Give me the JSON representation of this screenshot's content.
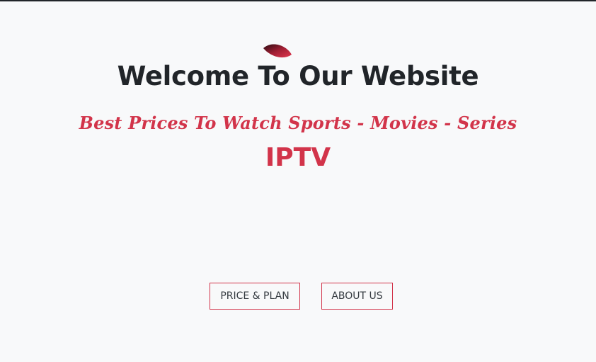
{
  "hero": {
    "logo_icon": "leaf-logo-icon",
    "title": "Welcome To Our Website",
    "subtitle": "Best Prices To Watch Sports - Movies - Series",
    "brand": "IPTV"
  },
  "buttons": {
    "price_plan": "PRICE & PLAN",
    "about_us": "ABOUT US"
  },
  "colors": {
    "background": "#f8f9fa",
    "accent": "#d2344a",
    "text": "#212529"
  }
}
